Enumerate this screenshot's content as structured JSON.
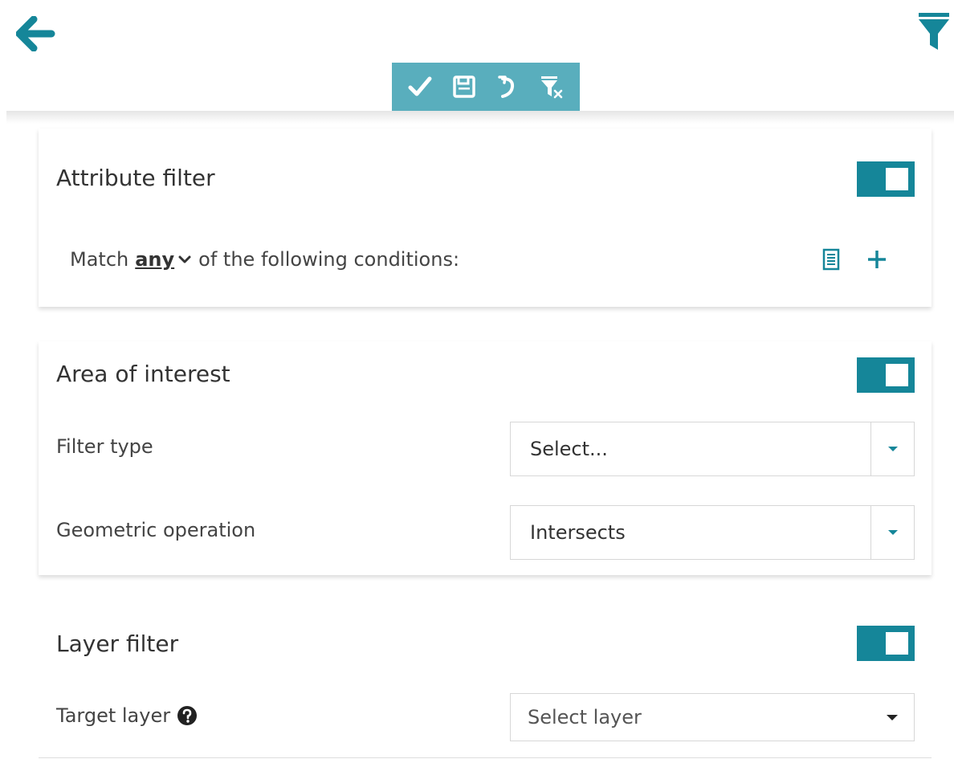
{
  "header": {
    "back_icon": "arrow-left-icon",
    "filter_icon": "funnel-icon",
    "accent_color": "#158699",
    "toolbar_color": "#59aebd",
    "toolbar": [
      {
        "icon": "check-icon",
        "action": "apply"
      },
      {
        "icon": "save-icon",
        "action": "save"
      },
      {
        "icon": "undo-icon",
        "action": "undo"
      },
      {
        "icon": "clear-filter-icon",
        "action": "clear"
      }
    ]
  },
  "attribute_filter": {
    "title": "Attribute filter",
    "enabled": true,
    "match_prefix": "Match",
    "match_value": "any",
    "match_suffix": "of the following conditions:"
  },
  "area_of_interest": {
    "title": "Area of interest",
    "enabled": true,
    "filter_type_label": "Filter type",
    "filter_type_value": "Select...",
    "geometric_operation_label": "Geometric operation",
    "geometric_operation_value": "Intersects"
  },
  "layer_filter": {
    "title": "Layer filter",
    "enabled": true,
    "target_layer_label": "Target layer",
    "target_layer_placeholder": "Select layer"
  }
}
